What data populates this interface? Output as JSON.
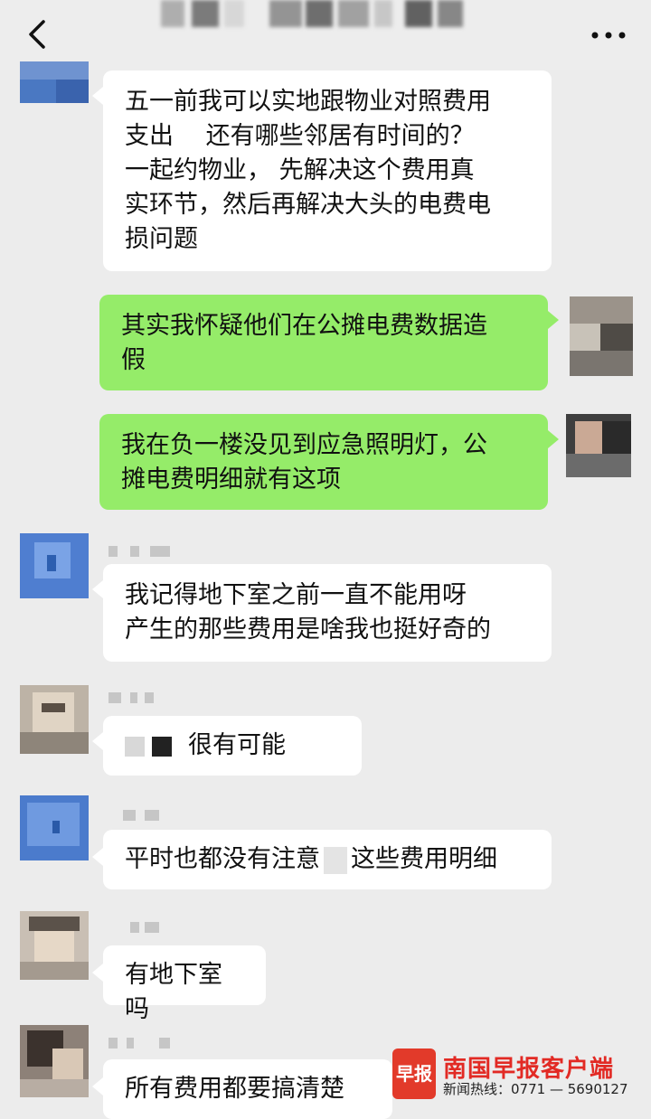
{
  "header": {
    "title": "",
    "back_icon": "chevron-left-icon",
    "more_icon": "more-dots-icon"
  },
  "colors": {
    "background": "#ececec",
    "incoming_bubble": "#ffffff",
    "outgoing_bubble": "#95ec69",
    "watermark_red": "#e22a24"
  },
  "messages": [
    {
      "side": "left",
      "lines": [
        "五一前我可以实地跟物业对照费用",
        "支出　 还有哪些邻居有时间的？",
        "一起约物业， 先解决这个费用真",
        "实环节，然后再解决大头的电费电",
        "损问题"
      ]
    },
    {
      "side": "right",
      "lines": [
        "其实我怀疑他们在公摊电费数据造",
        "假"
      ]
    },
    {
      "side": "right",
      "lines": [
        "我在负一楼没见到应急照明灯，公",
        "摊电费明细就有这项"
      ]
    },
    {
      "side": "left",
      "lines": [
        "我记得地下室之前一直不能用呀",
        "产生的那些费用是啥我也挺好奇的"
      ]
    },
    {
      "side": "left",
      "text": "很有可能"
    },
    {
      "side": "left",
      "lines": [
        "平时也都没有注意",
        "这些费用明细"
      ]
    },
    {
      "side": "left",
      "text": "有地下室吗"
    },
    {
      "side": "left",
      "text": "所有费用都要搞清楚"
    }
  ],
  "watermark": {
    "logo_text": "早报",
    "title": "南国早报客户端",
    "hotline": "新闻热线：0771 — 5690127"
  }
}
